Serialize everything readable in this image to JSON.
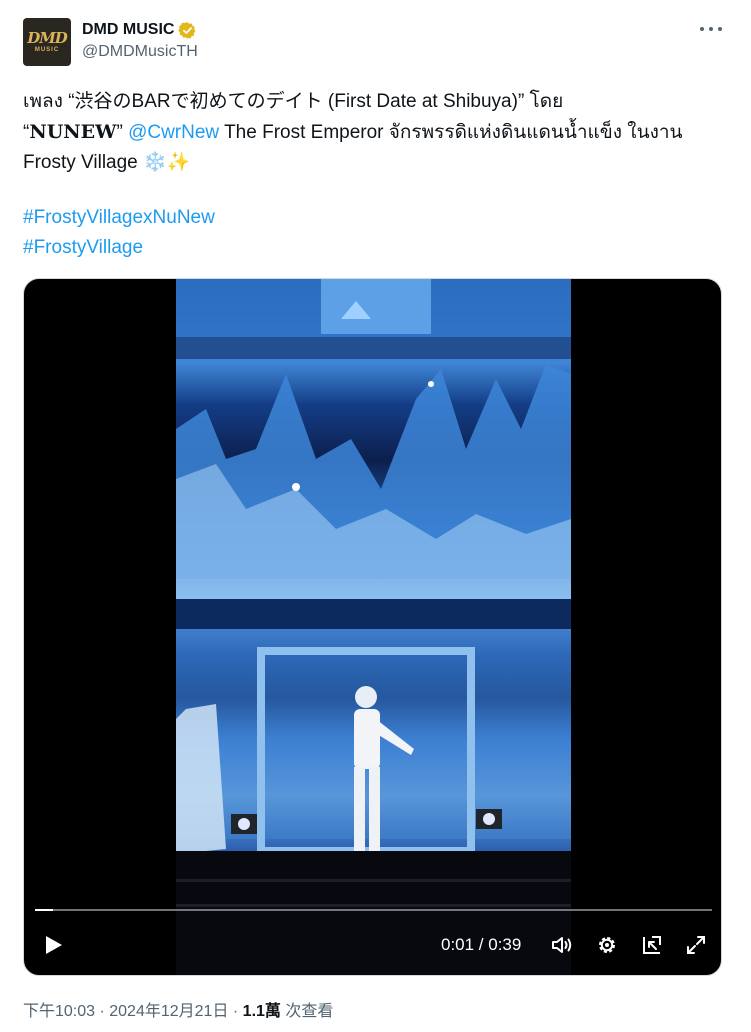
{
  "author": {
    "avatar_text": "DMD",
    "avatar_subtext": "MUSIC",
    "display_name": "DMD MUSIC",
    "handle": "@DMDMusicTH",
    "verified_icon": "verified-badge-gold",
    "verified_color": "#e2b719"
  },
  "more_icon": "more-horizontal-icon",
  "tweet": {
    "line1": "เพลง “渋谷のBARで初めてのデイト (First Date at Shibuya)” โดย",
    "line2_open_quote": "“",
    "line2_bold": "NUNEW",
    "line2_close_quote": "” ",
    "mention": "@CwrNew",
    "line2_rest": " The Frost Emperor จักรพรรดิแห่งดินแดนน้ำแข็ง ในงาน",
    "line3": "Frosty Village ❄️✨",
    "hashtags": [
      "#FrostyVillagexNuNew",
      "#FrostyVillage"
    ],
    "link_color": "#1d9bf0"
  },
  "video": {
    "progress": 0.026,
    "current_time": "0:01",
    "duration": "0:39",
    "time_text": "0:01 / 0:39",
    "icons": [
      "play-icon",
      "volume-icon",
      "settings-icon",
      "pip-icon",
      "fullscreen-icon"
    ]
  },
  "meta": {
    "timestamp": "下午10:03 · 2024年12月21日 · ",
    "views_count": "1.1萬",
    "views_label": " 次查看"
  }
}
